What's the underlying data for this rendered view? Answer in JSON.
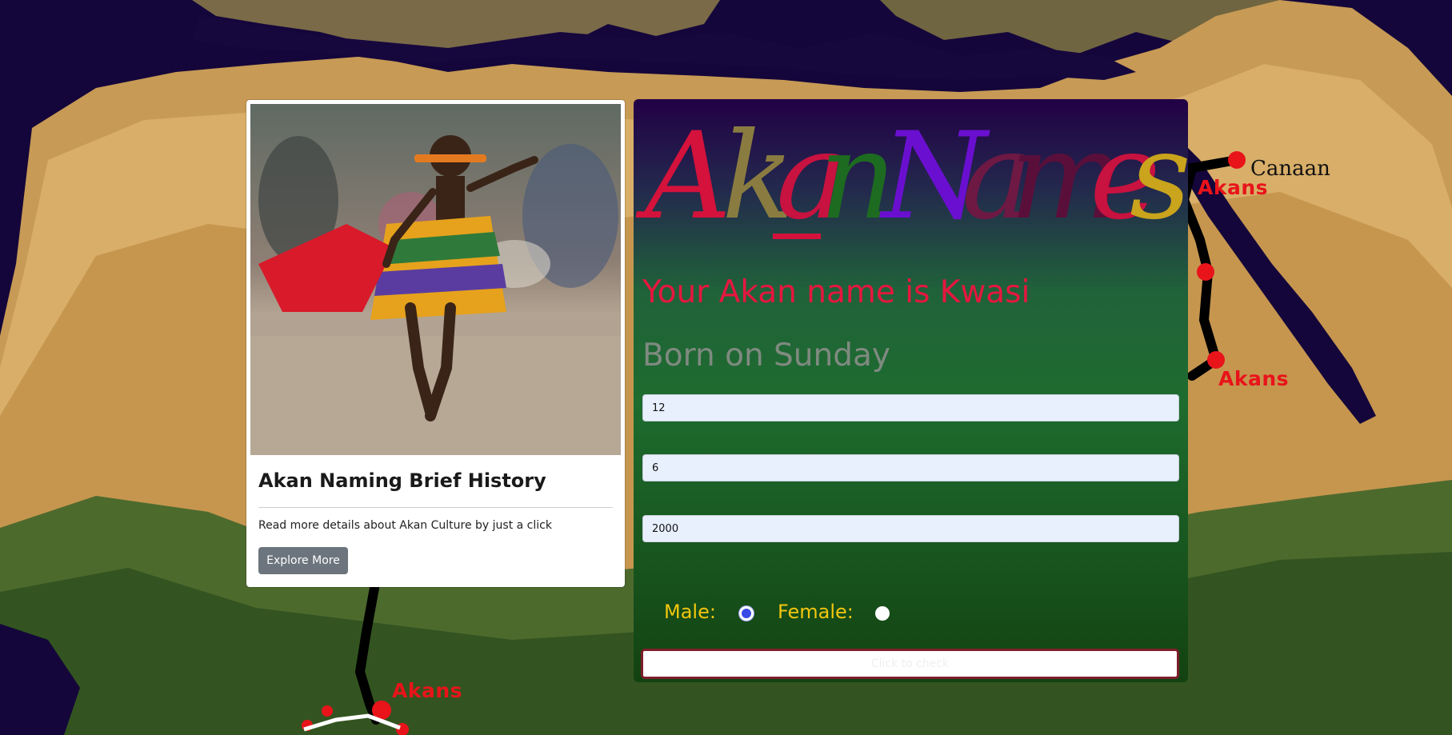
{
  "map": {
    "labels": [
      "Akans",
      "Akans",
      "Akans"
    ],
    "place": "Canaan"
  },
  "card": {
    "image_alt": "Child in kente cloth dancing",
    "title": "Akan Naming Brief History",
    "text": "Read more details about Akan Culture by just a click",
    "button": "Explore More"
  },
  "panel": {
    "logo_text": "Akan Names",
    "result_name": "Your Akan name is Kwasi",
    "result_day": "Born on Sunday",
    "fields": {
      "day": "12",
      "month": "6",
      "year": "2000"
    },
    "gender": {
      "male_label": "Male:",
      "female_label": "Female:",
      "selected": "male"
    },
    "submit": "Click to check"
  },
  "colors": {
    "map_label": "#e8141a",
    "result_name": "#e5173f",
    "result_day": "#7f8a80",
    "gender_label": "#f2c60e",
    "button_gray": "#6c757d",
    "submit_border": "#7d1e2c"
  }
}
